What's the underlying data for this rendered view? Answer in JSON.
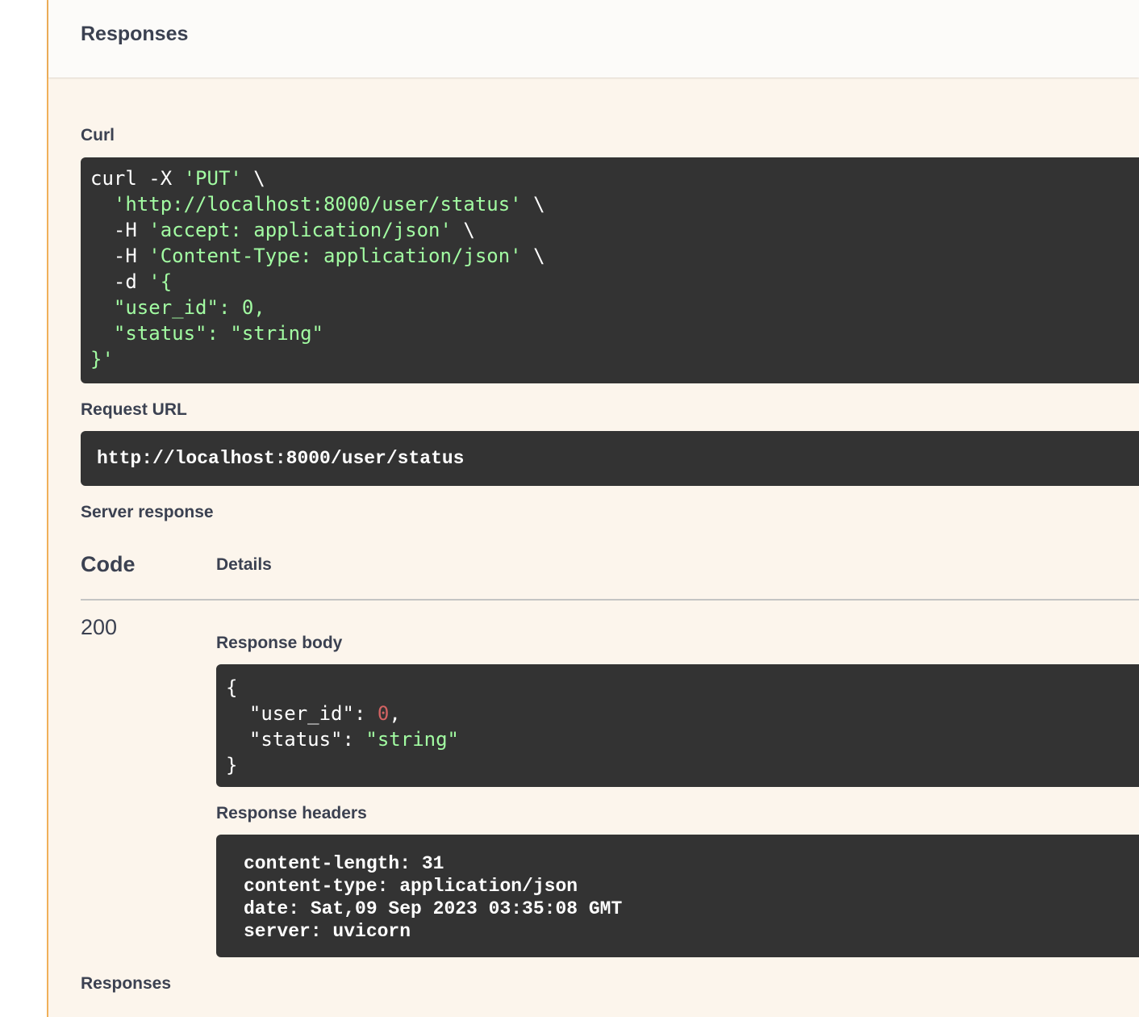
{
  "header": {
    "title": "Responses"
  },
  "curl": {
    "label": "Curl",
    "line1_cmd": "curl -X ",
    "line1_method": "'PUT'",
    "line1_end": " \\",
    "line2_url": "  'http://localhost:8000/user/status'",
    "line2_end": " \\",
    "line3_flag": "  -H ",
    "line3_val": "'accept: application/json'",
    "line3_end": " \\",
    "line4_flag": "  -H ",
    "line4_val": "'Content-Type: application/json'",
    "line4_end": " \\",
    "line5_flag": "  -d ",
    "line5_val": "'{",
    "line6": "  \"user_id\": 0,",
    "line7": "  \"status\": \"string\"",
    "line8": "}'"
  },
  "request_url": {
    "label": "Request URL",
    "value": "http://localhost:8000/user/status"
  },
  "server_response": {
    "label": "Server response",
    "col_code": "Code",
    "col_details": "Details",
    "status_code": "200",
    "body_label": "Response body",
    "body": {
      "open": "{",
      "key1": "  \"user_id\"",
      "sep1": ": ",
      "val1": "0",
      "comma1": ",",
      "key2": "  \"status\"",
      "sep2": ": ",
      "val2": "\"string\"",
      "close": "}"
    },
    "headers_label": "Response headers",
    "headers": [
      "content-length: 31",
      "content-type: application/json",
      "date: Sat,09 Sep 2023 03:35:08 GMT",
      "server: uvicorn"
    ]
  },
  "footer": {
    "label": "Responses"
  }
}
